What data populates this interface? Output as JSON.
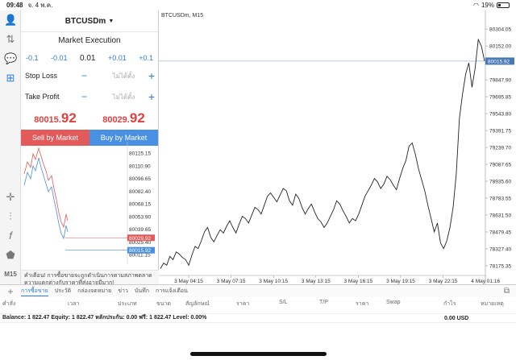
{
  "status": {
    "time": "09:48",
    "date": "จ. 4 พ.ค.",
    "battery": "19%",
    "battery_level": 0.19
  },
  "toolbar_icons": [
    "user-icon",
    "trade-icon",
    "chat-icon",
    "new-order-icon",
    "crosshair-icon",
    "indicator-icon",
    "function-icon",
    "objects-icon"
  ],
  "timeframe": "M15",
  "panel": {
    "symbol": "BTCUSDm",
    "execution": "Market Execution",
    "volume_adjust": [
      "-0.1",
      "-0.01",
      "+0.01",
      "+0.1"
    ],
    "volume": "0.01",
    "stop_loss_label": "Stop Loss",
    "take_profit_label": "Take Profit",
    "sl_placeholder": "ไม่ได้ตั้ง",
    "tp_placeholder": "ไม่ได้ตั้ง",
    "sell_price_prefix": "80015.",
    "sell_price_suffix": "92",
    "buy_price_prefix": "80029.",
    "buy_price_suffix": "92",
    "sell_label": "Sell by Market",
    "buy_label": "Buy by Market",
    "mini_axis": [
      "80125.15",
      "80110.90",
      "80096.65",
      "80082.40",
      "80068.15",
      "80053.90",
      "80039.65",
      "80025.40",
      "80011.15"
    ],
    "mini_ask_tag": "80029.92",
    "mini_bid_tag": "80015.92",
    "warning": "คำเตือน! การซื้อขายจะถูกดำเนินการตามสภาพตลาด ความแตกต่างกับราคาที่ส่งอาจมีมาก!"
  },
  "chart_data": {
    "type": "line",
    "title": "BTCUSDm, M15",
    "x_labels": [
      "3 May 04:15",
      "3 May 07:15",
      "3 May 10:15",
      "3 May 13:15",
      "3 May 16:15",
      "3 May 19:15",
      "3 May 22:15",
      "4 May 01:16"
    ],
    "y_ticks": [
      "80304.05",
      "80152.00",
      "80015.92",
      "79847.90",
      "79695.85",
      "79543.80",
      "79391.75",
      "79239.70",
      "79087.65",
      "78935.60",
      "78783.55",
      "78631.50",
      "78479.45",
      "78327.40",
      "78175.35"
    ],
    "ylim": [
      78110,
      80370
    ],
    "current_price_label": "80015.92",
    "current_price": 80015.92,
    "series": [
      {
        "values": [
          78150,
          78200,
          78180,
          78260,
          78230,
          78300,
          78280,
          78250,
          78230,
          78180,
          78270,
          78350,
          78330,
          78400,
          78480,
          78520,
          78430,
          78390,
          78450,
          78500,
          78470,
          78530,
          78580,
          78520,
          78470,
          78550,
          78620,
          78600,
          78560,
          78630,
          78700,
          78680,
          78640,
          78720,
          78800,
          78830,
          78790,
          78750,
          78810,
          78870,
          78850,
          78760,
          78720,
          78820,
          78780,
          78700,
          78640,
          78690,
          78730,
          78660,
          78600,
          78570,
          78520,
          78560,
          78620,
          78680,
          78760,
          78730,
          78670,
          78620,
          78560,
          78600,
          78580,
          78640,
          78720,
          78800,
          78850,
          78900,
          78960,
          78930,
          78870,
          78910,
          78980,
          78950,
          78900,
          78860,
          78960,
          79050,
          79120,
          79250,
          79280,
          79180,
          79050,
          78950,
          78850,
          78720,
          78600,
          78480,
          78560,
          78380,
          78330,
          78400,
          78520,
          78700,
          79000,
          79500,
          79720,
          79900,
          80000,
          79780,
          79950,
          80210,
          80150,
          80016
        ]
      }
    ],
    "grid": false
  },
  "tabs": [
    "การซื้อขาย",
    "ประวัติ",
    "กล่องจดหมาย",
    "ข่าว",
    "บันทึก",
    "การแจ้งเตือน"
  ],
  "columns": [
    "คำสั่ง",
    "เวลา",
    "ประเภท",
    "ขนาด",
    "สัญลักษณ์",
    "ราคา",
    "S/L",
    "T/P",
    "ราคา",
    "Swap",
    "กำไร",
    "หมายเหตุ"
  ],
  "balance": {
    "text": "Balance: 1 822.47 Equity: 1 822.47 หลักประกัน: 0.00 ฟรี: 1 822.47 Level: 0.00%",
    "profit": "0.00  USD"
  },
  "colors": {
    "accent": "#2d7be0",
    "sell": "#e25a5a",
    "buy": "#4a90e2",
    "price_red": "#e04040"
  }
}
